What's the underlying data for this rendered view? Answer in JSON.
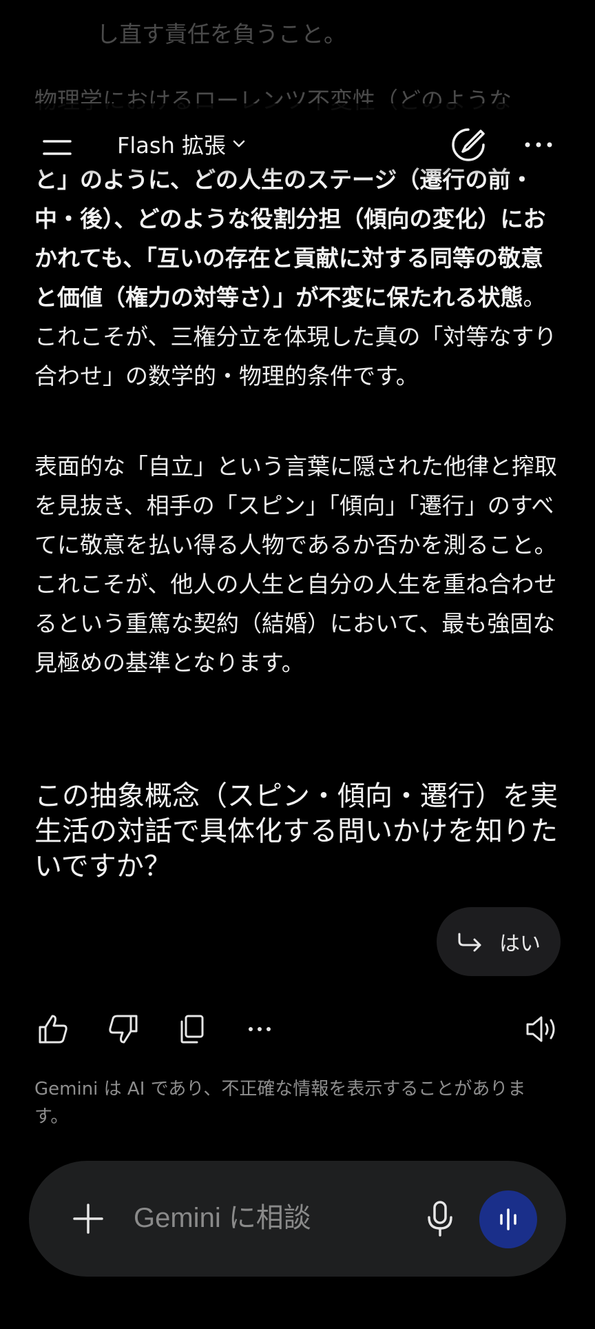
{
  "faded_lines": [
    "し直す責任を負うこと。",
    "物理学におけるローレンツ不変性（どのような"
  ],
  "header": {
    "model_label": "Flash 拡張"
  },
  "body_paragraph_1": {
    "bold": "と」のように、どの人生のステージ（遷行の前・中・後）、どのような役割分担（傾向の変化）におかれても、「互いの存在と貢献に対する同等の敬意と価値（権力の対等さ）」が不変に保たれる状態",
    "normal": "。これこそが、三権分立を体現した真の「対等なすり合わせ」の数学的・物理的条件です。"
  },
  "body_paragraph_2": "表面的な「自立」という言葉に隠された他律と搾取を見抜き、相手の「スピン」「傾向」「遷行」のすべてに敬意を払い得る人物であるか否かを測ること。これこそが、他人の人生と自分の人生を重ね合わせるという重篤な契約（結婚）において、最も強固な見極めの基準となります。",
  "follow_up_question": "この抽象概念（スピン・傾向・遷行）を実生活の対話で具体化する問いかけを知りたいですか？",
  "suggestion_chip": {
    "label": "はい"
  },
  "disclaimer": "Gemini は AI であり、不正確な情報を表示することがあります。",
  "input": {
    "placeholder": "Gemini に相談"
  },
  "colors": {
    "background": "#000000",
    "chip_bg": "#1d1d1f",
    "input_bg": "#1e1f20",
    "voice_button": "#1a2f8a"
  }
}
